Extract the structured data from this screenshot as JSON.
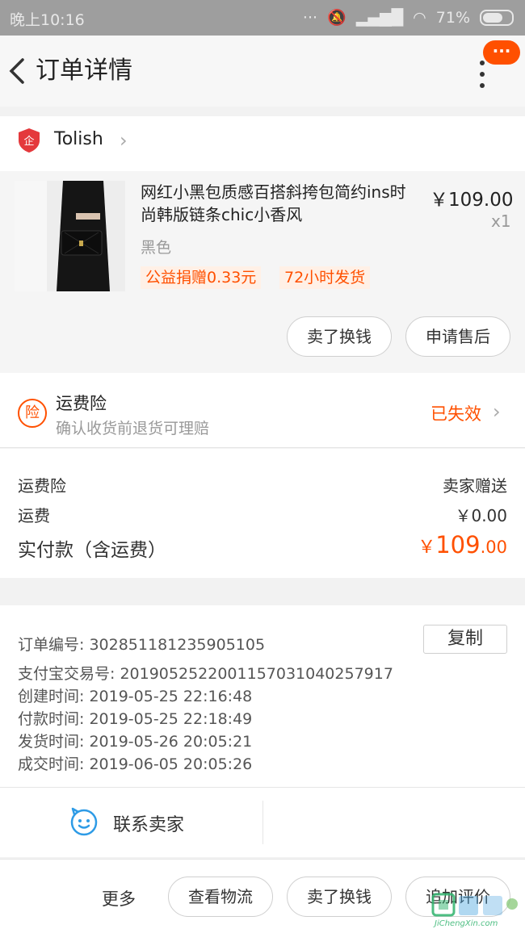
{
  "status_bar": {
    "time": "晚上10:16",
    "battery": "71%"
  },
  "header": {
    "title": "订单详情"
  },
  "shop": {
    "name": "Tolish",
    "badge_char": "企"
  },
  "product": {
    "title": "网红小黑包质感百搭斜挎包简约ins时尚韩版链条chic小香风",
    "price": "￥109.00",
    "qty": "x1",
    "sku": "黑色",
    "tags": [
      "公益捐赠0.33元",
      "72小时发货"
    ],
    "buttons": [
      "卖了换钱",
      "申请售后"
    ]
  },
  "insurance": {
    "icon_char": "险",
    "title": "运费险",
    "subtitle": "确认收货前退货可理赔",
    "status": "已失效"
  },
  "fees": {
    "rows": [
      {
        "label": "运费险",
        "value": "卖家赠送"
      },
      {
        "label": "运费",
        "value": "￥0.00"
      }
    ],
    "total_label": "实付款（含运费）",
    "total_currency": "￥",
    "total_int": "109",
    "total_dec": ".00"
  },
  "order_info": {
    "copy_label": "复制",
    "rows": [
      {
        "label": "订单编号:",
        "value": "302851181235905105"
      },
      {
        "label": "支付宝交易号:",
        "value": "2019052522001157031040257917"
      },
      {
        "label": "创建时间:",
        "value": "2019-05-25 22:16:48"
      },
      {
        "label": "付款时间:",
        "value": "2019-05-25 22:18:49"
      },
      {
        "label": "发货时间:",
        "value": "2019-05-26 20:05:21"
      },
      {
        "label": "成交时间:",
        "value": "2019-06-05 20:05:26"
      }
    ]
  },
  "contact": {
    "label": "联系卖家"
  },
  "bottom_bar": {
    "more": "更多",
    "buttons": [
      "查看物流",
      "卖了换钱",
      "追加评价"
    ]
  },
  "watermark": {
    "text": "JiChengXin.com"
  },
  "colors": {
    "accent": "#ff5000",
    "tag_bg": "#fff0e6"
  }
}
